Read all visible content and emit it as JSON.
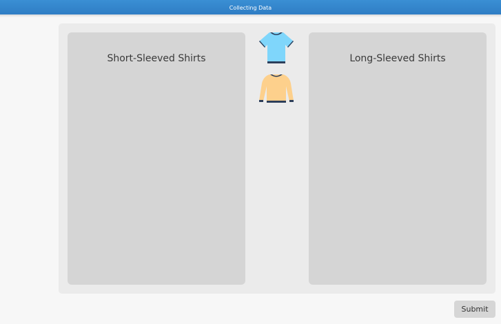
{
  "window": {
    "title": "Collecting Data"
  },
  "bins": {
    "left_label": "Short-Sleeved Shirts",
    "right_label": "Long-Sleeved Shirts"
  },
  "items": [
    {
      "icon": "short-sleeve-shirt-icon",
      "color": "#7fd6fb"
    },
    {
      "icon": "long-sleeve-shirt-icon",
      "color": "#fdd08c"
    }
  ],
  "footer": {
    "submit_label": "Submit"
  },
  "colors": {
    "title_bar": "#3a8fd4",
    "trim": "#2c3e5a"
  }
}
